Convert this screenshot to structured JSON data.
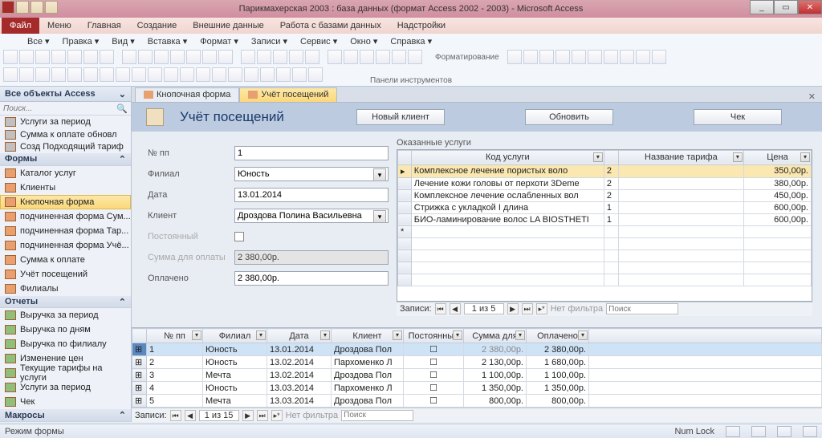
{
  "window": {
    "title": "Парикмахерская 2003 : база данных (формат Access 2002 - 2003)  -  Microsoft Access",
    "min": "_",
    "max": "▭",
    "close": "✕"
  },
  "menubar": {
    "file": "Файл",
    "tabs": [
      "Меню",
      "Главная",
      "Создание",
      "Внешние данные",
      "Работа с базами данных",
      "Надстройки"
    ]
  },
  "submenu": [
    "Все ▾",
    "Правка ▾",
    "Вид ▾",
    "Вставка ▾",
    "Формат ▾",
    "Записи ▾",
    "Сервис ▾",
    "Окно ▾",
    "Справка ▾"
  ],
  "ribbon": {
    "format_lbl": "Форматирование",
    "caption": "Панели инструментов"
  },
  "nav": {
    "header": "Все объекты Access",
    "search_ph": "Поиск...",
    "queries": [
      "Услуги за период",
      "Сумма к оплате обновл",
      "Созд Подходящий тариф"
    ],
    "cat_forms": "Формы",
    "forms": [
      "Каталог услуг",
      "Клиенты",
      "Кнопочная форма",
      "подчиненная форма Сум...",
      "подчиненная форма Тар...",
      "подчиненная форма Учё...",
      "Сумма к оплате",
      "Учёт посещений",
      "Филиалы"
    ],
    "cat_reports": "Отчеты",
    "reports": [
      "Выручка за период",
      "Выручка по дням",
      "Выручка по филиалу",
      "Изменение цен",
      "Текущие тарифы на услуги",
      "Услуги за период",
      "Чек"
    ],
    "cat_macros": "Макросы"
  },
  "doctabs": {
    "t1": "Кнопочная форма",
    "t2": "Учёт посещений"
  },
  "formheader": {
    "title": "Учёт посещений",
    "btn_new": "Новый клиент",
    "btn_refresh": "Обновить",
    "btn_check": "Чек"
  },
  "form": {
    "lbl_num": "№ пп",
    "val_num": "1",
    "lbl_branch": "Филиал",
    "val_branch": "Юность",
    "lbl_date": "Дата",
    "val_date": "13.01.2014",
    "lbl_client": "Клиент",
    "val_client": "Дроздова Полина Васильевна",
    "lbl_const": "Постоянный",
    "lbl_sum": "Сумма для оплаты",
    "val_sum": "2 380,00р.",
    "lbl_paid": "Оплачено",
    "val_paid": "2 380,00р."
  },
  "subform": {
    "title": "Оказанные услуги",
    "cols": [
      "",
      "Код услуги",
      "",
      "Название тарифа",
      "Цена"
    ],
    "rows": [
      {
        "svc": "Комплексное лечение пористых воло",
        "tar": "2",
        "price": "350,00р."
      },
      {
        "svc": "Лечение кожи головы от перхоти 3Deme",
        "tar": "2",
        "price": "380,00р."
      },
      {
        "svc": "Комплексное лечение ослабленных вол",
        "tar": "2",
        "price": "450,00р."
      },
      {
        "svc": "Стрижка с укладкой I длина",
        "tar": "1",
        "price": "600,00р."
      },
      {
        "svc": "БИО-ламинирование волос LA BIOSTHETI",
        "tar": "1",
        "price": "600,00р."
      }
    ],
    "recnav": {
      "label": "Записи:",
      "pos": "1 из 5",
      "nofilter": "Нет фильтра",
      "search": "Поиск"
    }
  },
  "datasheet": {
    "cols": [
      "№ пп",
      "Филиал",
      "Дата",
      "Клиент",
      "Постоянный",
      "Сумма для",
      "Оплачено"
    ],
    "rows": [
      {
        "n": "1",
        "br": "Юность",
        "dt": "13.01.2014",
        "cl": "Дроздова Пол",
        "sum": "2 380,00р.",
        "paid": "2 380,00р."
      },
      {
        "n": "2",
        "br": "Юность",
        "dt": "13.02.2014",
        "cl": "Пархоменко Л",
        "sum": "2 130,00р.",
        "paid": "1 680,00р."
      },
      {
        "n": "3",
        "br": "Мечта",
        "dt": "13.02.2014",
        "cl": "Дроздова Пол",
        "sum": "1 100,00р.",
        "paid": "1 100,00р."
      },
      {
        "n": "4",
        "br": "Юность",
        "dt": "13.03.2014",
        "cl": "Пархоменко Л",
        "sum": "1 350,00р.",
        "paid": "1 350,00р."
      },
      {
        "n": "5",
        "br": "Мечта",
        "dt": "13.03.2014",
        "cl": "Дроздова Пол",
        "sum": "800,00р.",
        "paid": "800,00р."
      }
    ],
    "recnav": {
      "label": "Записи:",
      "pos": "1 из 15",
      "nofilter": "Нет фильтра",
      "search": "Поиск"
    }
  },
  "status": {
    "mode": "Режим формы",
    "numlock": "Num Lock"
  }
}
